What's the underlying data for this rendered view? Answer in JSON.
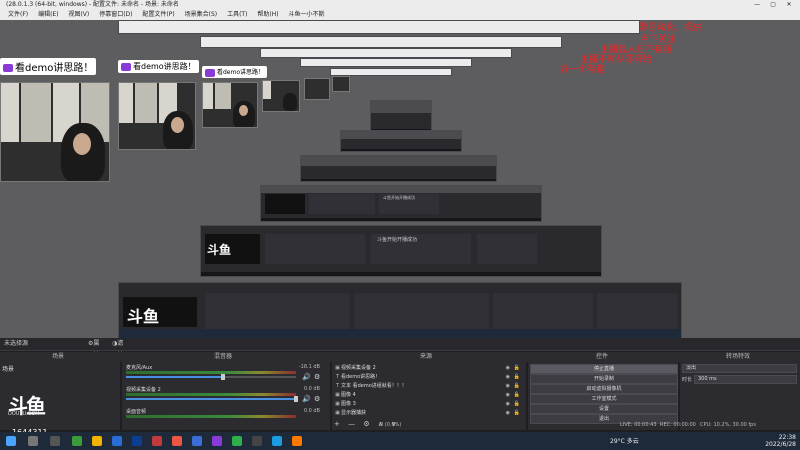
{
  "window": {
    "title": "(28.0.1.3 (64-bit, windows) - 配置文件: 未命名 - 场景: 未命名",
    "controls": [
      "—",
      "▢",
      "✕"
    ]
  },
  "menu": [
    "文件(F)",
    "编辑(E)",
    "视图(V)",
    "停靠窗口(D)",
    "配置文件(P)",
    "场景集合(S)",
    "工具(T)",
    "帮助(H)",
    "斗鱼一小不斯"
  ],
  "preview": {
    "cam_label": "看demo讲思路！",
    "danmaku": [
      "开源自动化，提供",
      "点下关注",
      "主播我人在不有趣",
      "主播不就从零开始",
      "好一个有趣"
    ],
    "nested_labels": [
      "斗鱼开始开播成功",
      "斗鱼开始开播成功"
    ]
  },
  "dock_title": {
    "label": "未选择源",
    "properties": "属性",
    "filters": "滤镜"
  },
  "dock_headers": {
    "scenes": "场景",
    "mixer": "混音器",
    "sources": "来源",
    "controls": "控件",
    "transitions": "转场特效"
  },
  "scenes": {
    "items": [
      "场景"
    ]
  },
  "douyu": {
    "logo": "斗鱼",
    "url": "DOUYU.COM",
    "room": "1644311"
  },
  "mixer": {
    "tracks": [
      {
        "name": "麦克风/Aux",
        "db": "-18.1 dB"
      },
      {
        "name": "视频采集设备 2",
        "db": "0.0 dB"
      },
      {
        "name": "桌面音频",
        "db": "0.0 dB"
      }
    ]
  },
  "sources": {
    "items": [
      {
        "icon": "▣",
        "label": "视频采集设备 2"
      },
      {
        "icon": "T",
        "label": "看demo讲思路！"
      },
      {
        "icon": "T",
        "label": "文本 看demo进组就看！！！"
      },
      {
        "icon": "▣",
        "label": "图像 4"
      },
      {
        "icon": "▣",
        "label": "图像 3"
      },
      {
        "icon": "▣",
        "label": "显示器捕获"
      }
    ],
    "tools": [
      "+",
      "—",
      "⚙",
      "∧",
      "∨"
    ]
  },
  "controls": {
    "buttons": [
      "停止直播",
      "开始录制",
      "启动虚拟摄像机",
      "工作室模式",
      "设置",
      "退出"
    ]
  },
  "transitions": {
    "type": "淡出",
    "duration_label": "时长",
    "duration_value": "300 ms"
  },
  "status": {
    "live": "LIVE: 00:00:43",
    "rec": "REC: 00:00:00",
    "cpu": "CPU: 10.2%, 30.00 fps",
    "frames": "0 (0.0%)"
  },
  "taskbar": {
    "weather": "29°C 多云",
    "time": "22:38",
    "date": "2022/6/28"
  },
  "colors": {
    "accent": "#4a90e2",
    "danmaku": "#ff2020",
    "panel_bg": "#2b2b30"
  }
}
